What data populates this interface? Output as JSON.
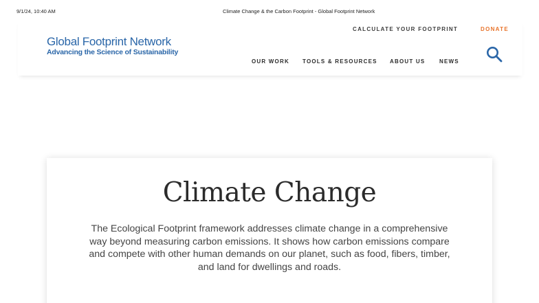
{
  "print_header": {
    "date": "9/1/24, 10:40 AM",
    "title": "Climate Change & the Carbon Footprint - Global Footprint Network"
  },
  "header": {
    "logo": {
      "name": "Global Footprint Network",
      "tagline": "Advancing the Science of Sustainability",
      "color": "#2a66a8"
    },
    "top_links": {
      "calculate": "CALCULATE YOUR FOOTPRINT",
      "donate": "DONATE",
      "donate_color": "#e8732a"
    },
    "nav": [
      "OUR WORK",
      "TOOLS & RESOURCES",
      "ABOUT US",
      "NEWS"
    ],
    "search_icon": "search-icon",
    "search_icon_color": "#2a66a8"
  },
  "main": {
    "title": "Climate Change",
    "body": "The Ecological Footprint framework addresses climate change in a comprehensive way beyond measuring carbon emissions. It shows how carbon emissions compare and compete with other human demands on our planet, such as food, fibers, timber, and land for dwellings and roads."
  }
}
